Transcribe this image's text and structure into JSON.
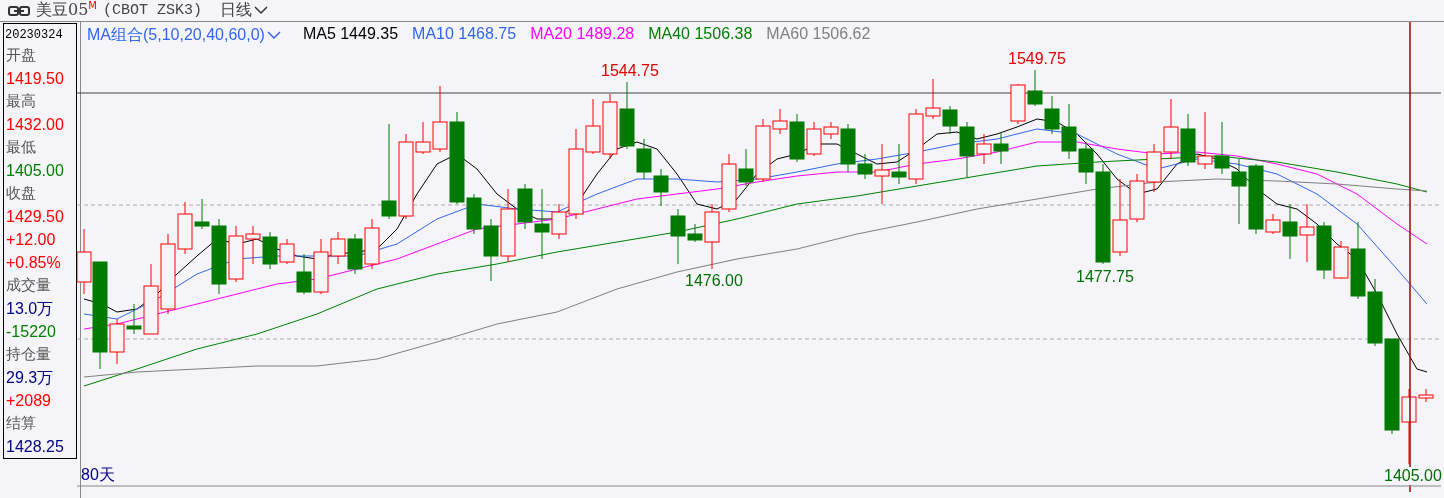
{
  "title_bar": {
    "symbol": "美豆05",
    "symbol_mark": "M",
    "code": "(CBOT ZSK3)",
    "period": "日线"
  },
  "info_panel": {
    "date": "20230324",
    "fields": [
      {
        "label": "开盘",
        "values": [
          {
            "text": "1419.50",
            "color": "#ff0000"
          }
        ]
      },
      {
        "label": "最高",
        "values": [
          {
            "text": "1432.00",
            "color": "#ff0000"
          }
        ]
      },
      {
        "label": "最低",
        "values": [
          {
            "text": "1405.00",
            "color": "#008000"
          }
        ]
      },
      {
        "label": "收盘",
        "values": [
          {
            "text": "1429.50",
            "color": "#ff0000"
          },
          {
            "text": "+12.00",
            "color": "#ff0000"
          },
          {
            "text": "+0.85%",
            "color": "#ff0000"
          }
        ]
      },
      {
        "label": "成交量",
        "values": [
          {
            "text": "13.0万",
            "color": "#000080"
          },
          {
            "text": "-15220",
            "color": "#008000"
          }
        ]
      },
      {
        "label": "持仓量",
        "values": [
          {
            "text": "29.3万",
            "color": "#000080"
          },
          {
            "text": "+2089",
            "color": "#ff0000"
          }
        ]
      },
      {
        "label": "结算",
        "values": [
          {
            "text": "1428.25",
            "color": "#000080"
          }
        ]
      }
    ]
  },
  "legend": {
    "selector": "MA组合(5,10,20,40,60,0)",
    "items": [
      {
        "name": "MA5",
        "value": "1449.35",
        "color": "#000000"
      },
      {
        "name": "MA10",
        "value": "1468.75",
        "color": "#3366ee"
      },
      {
        "name": "MA20",
        "value": "1489.28",
        "color": "#ff00ff"
      },
      {
        "name": "MA40",
        "value": "1506.38",
        "color": "#008000"
      },
      {
        "name": "MA60",
        "value": "1506.62",
        "color": "#808080"
      }
    ]
  },
  "annotations": [
    {
      "text": "1544.75",
      "kind": "high"
    },
    {
      "text": "1549.75",
      "kind": "high"
    },
    {
      "text": "1476.00",
      "kind": "low"
    },
    {
      "text": "1477.75",
      "kind": "low"
    },
    {
      "text": "1405.00",
      "kind": "axis"
    }
  ],
  "period_count": "80天"
}
